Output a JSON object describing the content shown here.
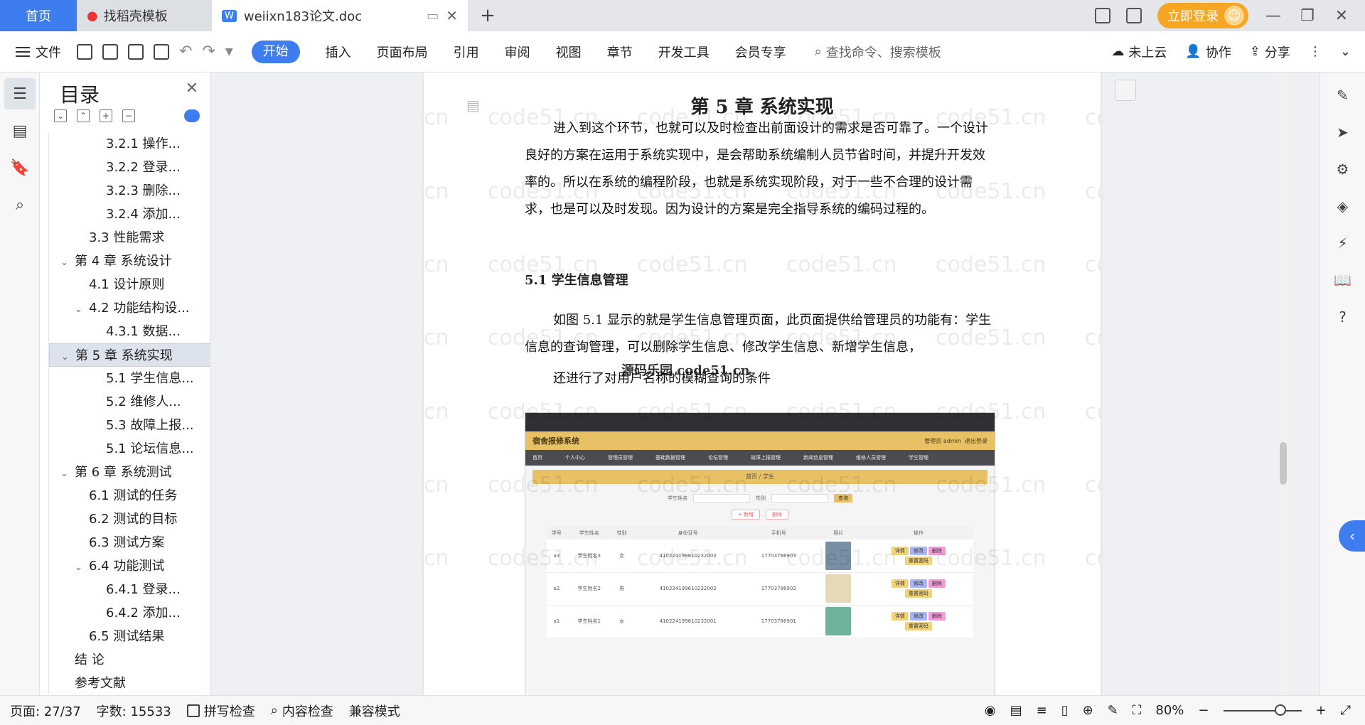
{
  "tabs": {
    "home": "首页",
    "templates": "找稻壳模板",
    "doc": "weiixn183论文.doc",
    "add": "+"
  },
  "titlebar": {
    "login": "立即登录"
  },
  "ribbon": {
    "file": "文件",
    "menus": [
      "开始",
      "插入",
      "页面布局",
      "引用",
      "审阅",
      "视图",
      "章节",
      "开发工具",
      "会员专享"
    ],
    "search_placeholder": "查找命令、搜索模板",
    "cloud": "未上云",
    "collab": "协作",
    "share": "分享"
  },
  "toc": {
    "title": "目录",
    "items": [
      {
        "label": "3.2.1 操作...",
        "level": 3
      },
      {
        "label": "3.2.2 登录...",
        "level": 3
      },
      {
        "label": "3.2.3 删除...",
        "level": 3
      },
      {
        "label": "3.2.4 添加...",
        "level": 3
      },
      {
        "label": "3.3 性能需求",
        "level": 2
      },
      {
        "label": "第 4 章 系统设计",
        "level": 1,
        "expand": true
      },
      {
        "label": "4.1 设计原则",
        "level": 2
      },
      {
        "label": "4.2 功能结构设...",
        "level": 2,
        "expand": true
      },
      {
        "label": "4.3.1 数据...",
        "level": 3
      },
      {
        "label": "第 5 章 系统实现",
        "level": 1,
        "expand": true,
        "selected": true
      },
      {
        "label": "5.1 学生信息...",
        "level": 3
      },
      {
        "label": "5.2 维修人...",
        "level": 3
      },
      {
        "label": "5.3 故障上报...",
        "level": 3
      },
      {
        "label": "5.1 论坛信息...",
        "level": 3
      },
      {
        "label": "第 6 章 系统测试",
        "level": 1,
        "expand": true
      },
      {
        "label": "6.1 测试的任务",
        "level": 2
      },
      {
        "label": "6.2 测试的目标",
        "level": 2
      },
      {
        "label": "6.3 测试方案",
        "level": 2
      },
      {
        "label": "6.4 功能测试",
        "level": 2,
        "expand": true
      },
      {
        "label": "6.4.1 登录...",
        "level": 3
      },
      {
        "label": "6.4.2 添加...",
        "level": 3
      },
      {
        "label": "6.5 测试结果",
        "level": 2
      },
      {
        "label": "结 论",
        "level": 1
      },
      {
        "label": "参考文献",
        "level": 1
      }
    ]
  },
  "document": {
    "chapter": "第 5 章 系统实现",
    "para1": "进入到这个环节，也就可以及时检查出前面设计的需求是否可靠了。一个设计良好的方案在运用于系统实现中，是会帮助系统编制人员节省时间，并提升开发效率的。所以在系统的编程阶段，也就是系统实现阶段，对于一些不合理的设计需求，也是可以及时发现。因为设计的方案是完全指导系统的编码过程的。",
    "section": "5.1 学生信息管理",
    "para2": "如图 5.1 显示的就是学生信息管理页面，此页面提供给管理员的功能有：学生信息的查询管理，可以删除学生信息、修改学生信息、新增学生信息，",
    "overlay": "源码乐园 code51.cn",
    "para3": "还进行了对用户名称的模糊查询的条件",
    "watermark": "code51.cn"
  },
  "screenshot": {
    "system_title": "宿舍报修系统",
    "admin": "管理员 admin",
    "logout": "退出登录",
    "nav": [
      "首页",
      "个人中心",
      "管理员管理",
      "基础数据管理",
      "论坛管理",
      "故障上报管理",
      "新闻信息管理",
      "维修人员管理",
      "学生管理"
    ],
    "crumb": "首页 / 学生",
    "filter_label": "学生姓名",
    "gender_label": "性别",
    "query": "查询",
    "add": "+ 新增",
    "delete": "删除",
    "columns": [
      "学号",
      "学生姓名",
      "性别",
      "身份证号",
      "手机号",
      "照片",
      "操作"
    ],
    "rows": [
      {
        "id": "a3",
        "name": "学生姓名3",
        "gender": "女",
        "idcard": "410224199610232003",
        "phone": "17703786903"
      },
      {
        "id": "a2",
        "name": "学生姓名2",
        "gender": "男",
        "idcard": "410224199610232002",
        "phone": "17703786902"
      },
      {
        "id": "a1",
        "name": "学生姓名1",
        "gender": "女",
        "idcard": "410224199610232001",
        "phone": "17703786901"
      }
    ],
    "actions": [
      "详情",
      "修改",
      "删除",
      "重置密码"
    ]
  },
  "status": {
    "page": "页面: 27/37",
    "words": "字数: 15533",
    "spell": "拼写检查",
    "content": "内容检查",
    "compat": "兼容模式",
    "zoom": "80%"
  },
  "colors": {
    "accent": "#3d7df0",
    "login": "#f6a623",
    "banner": "#e8c165"
  }
}
